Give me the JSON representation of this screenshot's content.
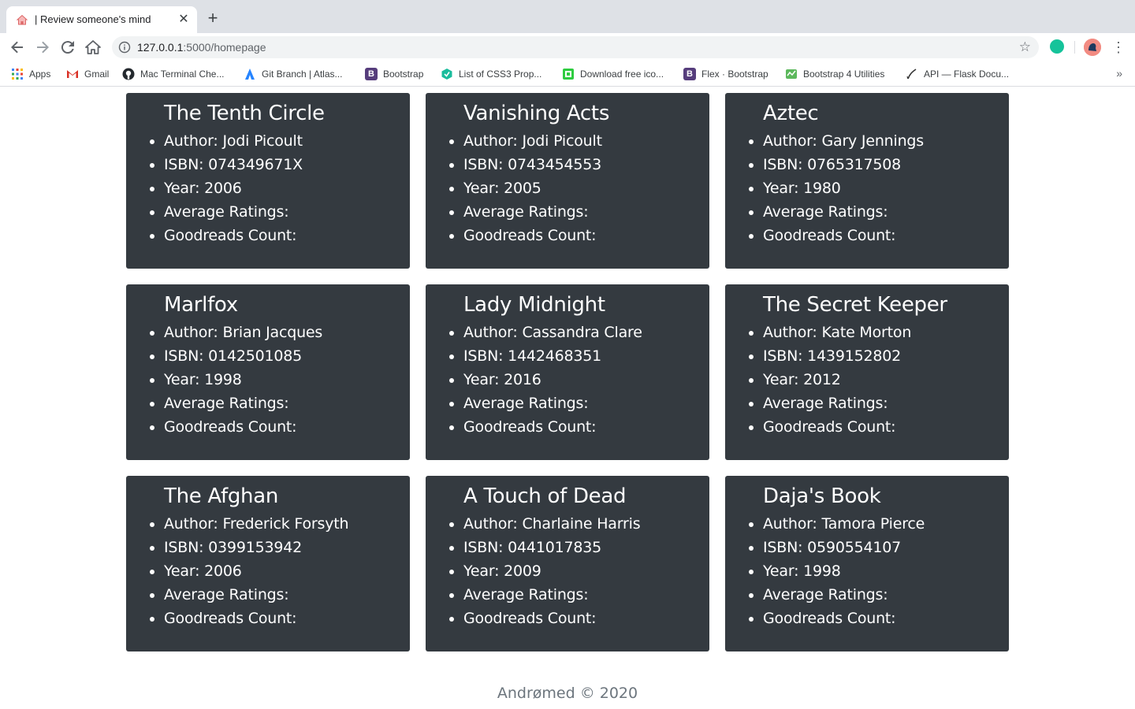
{
  "browser": {
    "tab_title": "| Review someone's mind",
    "url_host": "127.0.0.1",
    "url_path": ":5000/homepage",
    "bookmarks": [
      {
        "label": "Apps",
        "icon": "apps-grid-icon",
        "color": "#ea4335"
      },
      {
        "label": "Gmail",
        "icon": "gmail-icon",
        "color": "#d93025"
      },
      {
        "label": "Mac Terminal Che...",
        "icon": "github-icon",
        "color": "#24292e"
      },
      {
        "label": "Git Branch | Atlas...",
        "icon": "atlassian-icon",
        "color": "#2684ff"
      },
      {
        "label": "Bootstrap",
        "icon": "bootstrap-icon",
        "color": "#563d7c"
      },
      {
        "label": "List of CSS3 Prop...",
        "icon": "css-list-icon",
        "color": "#1abc9c"
      },
      {
        "label": "Download free ico...",
        "icon": "icons-download-icon",
        "color": "#2ecc40"
      },
      {
        "label": "Flex · Bootstrap",
        "icon": "bootstrap-icon",
        "color": "#563d7c"
      },
      {
        "label": "Bootstrap 4 Utilities",
        "icon": "utilities-icon",
        "color": "#5cb85c"
      },
      {
        "label": "API — Flask Docu...",
        "icon": "flask-icon",
        "color": "#333333"
      }
    ]
  },
  "books": [
    {
      "title": "The Tenth Circle",
      "author": "Author: Jodi Picoult",
      "isbn": "ISBN: 074349671X",
      "year": "Year: 2006",
      "avg": "Average Ratings:",
      "count": "Goodreads Count:"
    },
    {
      "title": "Vanishing Acts",
      "author": "Author: Jodi Picoult",
      "isbn": "ISBN: 0743454553",
      "year": "Year: 2005",
      "avg": "Average Ratings:",
      "count": "Goodreads Count:"
    },
    {
      "title": "Aztec",
      "author": "Author: Gary Jennings",
      "isbn": "ISBN: 0765317508",
      "year": "Year: 1980",
      "avg": "Average Ratings:",
      "count": "Goodreads Count:"
    },
    {
      "title": "Marlfox",
      "author": "Author: Brian Jacques",
      "isbn": "ISBN: 0142501085",
      "year": "Year: 1998",
      "avg": "Average Ratings:",
      "count": "Goodreads Count:"
    },
    {
      "title": "Lady Midnight",
      "author": "Author: Cassandra Clare",
      "isbn": "ISBN: 1442468351",
      "year": "Year: 2016",
      "avg": "Average Ratings:",
      "count": "Goodreads Count:"
    },
    {
      "title": "The Secret Keeper",
      "author": "Author: Kate Morton",
      "isbn": "ISBN: 1439152802",
      "year": "Year: 2012",
      "avg": "Average Ratings:",
      "count": "Goodreads Count:"
    },
    {
      "title": "The Afghan",
      "author": "Author: Frederick Forsyth",
      "isbn": "ISBN: 0399153942",
      "year": "Year: 2006",
      "avg": "Average Ratings:",
      "count": "Goodreads Count:"
    },
    {
      "title": "A Touch of Dead",
      "author": "Author: Charlaine Harris",
      "isbn": "ISBN: 0441017835",
      "year": "Year: 2009",
      "avg": "Average Ratings:",
      "count": "Goodreads Count:"
    },
    {
      "title": "Daja's Book",
      "author": "Author: Tamora Pierce",
      "isbn": "ISBN: 0590554107",
      "year": "Year: 1998",
      "avg": "Average Ratings:",
      "count": "Goodreads Count:"
    }
  ],
  "footer": {
    "text": "Andrømed © 2020"
  }
}
